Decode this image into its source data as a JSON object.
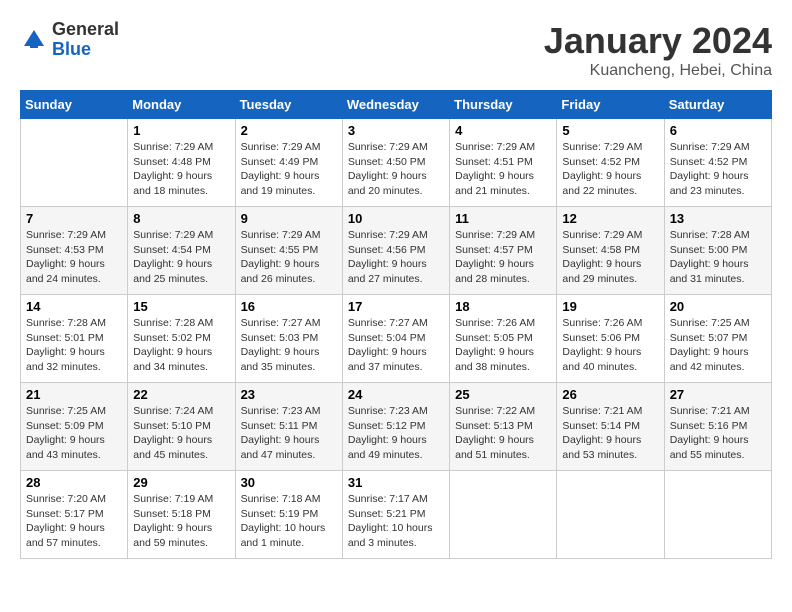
{
  "logo": {
    "general": "General",
    "blue": "Blue"
  },
  "header": {
    "month": "January 2024",
    "location": "Kuancheng, Hebei, China"
  },
  "weekdays": [
    "Sunday",
    "Monday",
    "Tuesday",
    "Wednesday",
    "Thursday",
    "Friday",
    "Saturday"
  ],
  "weeks": [
    [
      {
        "day": "",
        "info": ""
      },
      {
        "day": "1",
        "info": "Sunrise: 7:29 AM\nSunset: 4:48 PM\nDaylight: 9 hours\nand 18 minutes."
      },
      {
        "day": "2",
        "info": "Sunrise: 7:29 AM\nSunset: 4:49 PM\nDaylight: 9 hours\nand 19 minutes."
      },
      {
        "day": "3",
        "info": "Sunrise: 7:29 AM\nSunset: 4:50 PM\nDaylight: 9 hours\nand 20 minutes."
      },
      {
        "day": "4",
        "info": "Sunrise: 7:29 AM\nSunset: 4:51 PM\nDaylight: 9 hours\nand 21 minutes."
      },
      {
        "day": "5",
        "info": "Sunrise: 7:29 AM\nSunset: 4:52 PM\nDaylight: 9 hours\nand 22 minutes."
      },
      {
        "day": "6",
        "info": "Sunrise: 7:29 AM\nSunset: 4:52 PM\nDaylight: 9 hours\nand 23 minutes."
      }
    ],
    [
      {
        "day": "7",
        "info": "Sunrise: 7:29 AM\nSunset: 4:53 PM\nDaylight: 9 hours\nand 24 minutes."
      },
      {
        "day": "8",
        "info": "Sunrise: 7:29 AM\nSunset: 4:54 PM\nDaylight: 9 hours\nand 25 minutes."
      },
      {
        "day": "9",
        "info": "Sunrise: 7:29 AM\nSunset: 4:55 PM\nDaylight: 9 hours\nand 26 minutes."
      },
      {
        "day": "10",
        "info": "Sunrise: 7:29 AM\nSunset: 4:56 PM\nDaylight: 9 hours\nand 27 minutes."
      },
      {
        "day": "11",
        "info": "Sunrise: 7:29 AM\nSunset: 4:57 PM\nDaylight: 9 hours\nand 28 minutes."
      },
      {
        "day": "12",
        "info": "Sunrise: 7:29 AM\nSunset: 4:58 PM\nDaylight: 9 hours\nand 29 minutes."
      },
      {
        "day": "13",
        "info": "Sunrise: 7:28 AM\nSunset: 5:00 PM\nDaylight: 9 hours\nand 31 minutes."
      }
    ],
    [
      {
        "day": "14",
        "info": "Sunrise: 7:28 AM\nSunset: 5:01 PM\nDaylight: 9 hours\nand 32 minutes."
      },
      {
        "day": "15",
        "info": "Sunrise: 7:28 AM\nSunset: 5:02 PM\nDaylight: 9 hours\nand 34 minutes."
      },
      {
        "day": "16",
        "info": "Sunrise: 7:27 AM\nSunset: 5:03 PM\nDaylight: 9 hours\nand 35 minutes."
      },
      {
        "day": "17",
        "info": "Sunrise: 7:27 AM\nSunset: 5:04 PM\nDaylight: 9 hours\nand 37 minutes."
      },
      {
        "day": "18",
        "info": "Sunrise: 7:26 AM\nSunset: 5:05 PM\nDaylight: 9 hours\nand 38 minutes."
      },
      {
        "day": "19",
        "info": "Sunrise: 7:26 AM\nSunset: 5:06 PM\nDaylight: 9 hours\nand 40 minutes."
      },
      {
        "day": "20",
        "info": "Sunrise: 7:25 AM\nSunset: 5:07 PM\nDaylight: 9 hours\nand 42 minutes."
      }
    ],
    [
      {
        "day": "21",
        "info": "Sunrise: 7:25 AM\nSunset: 5:09 PM\nDaylight: 9 hours\nand 43 minutes."
      },
      {
        "day": "22",
        "info": "Sunrise: 7:24 AM\nSunset: 5:10 PM\nDaylight: 9 hours\nand 45 minutes."
      },
      {
        "day": "23",
        "info": "Sunrise: 7:23 AM\nSunset: 5:11 PM\nDaylight: 9 hours\nand 47 minutes."
      },
      {
        "day": "24",
        "info": "Sunrise: 7:23 AM\nSunset: 5:12 PM\nDaylight: 9 hours\nand 49 minutes."
      },
      {
        "day": "25",
        "info": "Sunrise: 7:22 AM\nSunset: 5:13 PM\nDaylight: 9 hours\nand 51 minutes."
      },
      {
        "day": "26",
        "info": "Sunrise: 7:21 AM\nSunset: 5:14 PM\nDaylight: 9 hours\nand 53 minutes."
      },
      {
        "day": "27",
        "info": "Sunrise: 7:21 AM\nSunset: 5:16 PM\nDaylight: 9 hours\nand 55 minutes."
      }
    ],
    [
      {
        "day": "28",
        "info": "Sunrise: 7:20 AM\nSunset: 5:17 PM\nDaylight: 9 hours\nand 57 minutes."
      },
      {
        "day": "29",
        "info": "Sunrise: 7:19 AM\nSunset: 5:18 PM\nDaylight: 9 hours\nand 59 minutes."
      },
      {
        "day": "30",
        "info": "Sunrise: 7:18 AM\nSunset: 5:19 PM\nDaylight: 10 hours\nand 1 minute."
      },
      {
        "day": "31",
        "info": "Sunrise: 7:17 AM\nSunset: 5:21 PM\nDaylight: 10 hours\nand 3 minutes."
      },
      {
        "day": "",
        "info": ""
      },
      {
        "day": "",
        "info": ""
      },
      {
        "day": "",
        "info": ""
      }
    ]
  ]
}
